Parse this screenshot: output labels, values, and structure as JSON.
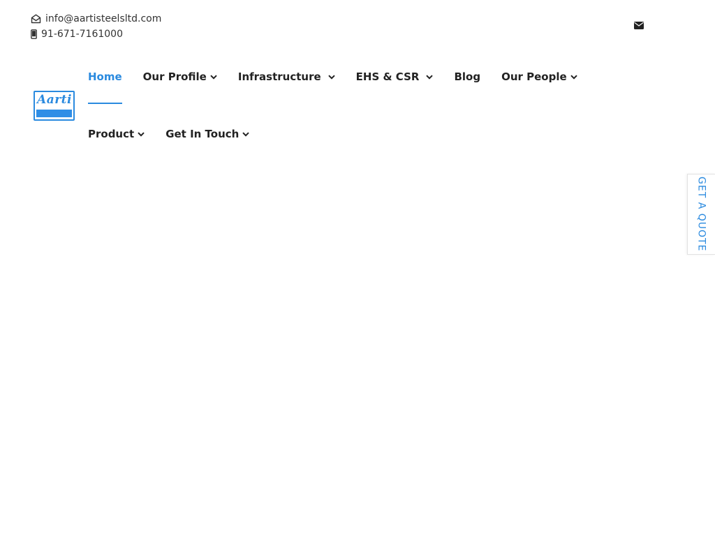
{
  "contact": {
    "email": "info@aartisteelsltd.com",
    "phone": "91-671-7161000",
    "email_icon": "envelope-open-icon",
    "phone_icon": "mobile-phone-icon",
    "top_mail_icon": "envelope-icon"
  },
  "logo": {
    "text": "Aarti",
    "color": "#2a8adf"
  },
  "nav": {
    "items": [
      {
        "label": "Home",
        "has_dropdown": false,
        "active": true
      },
      {
        "label": "Our Profile",
        "has_dropdown": true,
        "active": false
      },
      {
        "label": "Infrastructure",
        "has_dropdown": true,
        "active": false
      },
      {
        "label": "EHS & CSR",
        "has_dropdown": true,
        "active": false
      },
      {
        "label": "Blog",
        "has_dropdown": false,
        "active": false
      },
      {
        "label": "Our People",
        "has_dropdown": true,
        "active": false
      },
      {
        "label": "Product",
        "has_dropdown": true,
        "active": false
      },
      {
        "label": "Get In Touch",
        "has_dropdown": true,
        "active": false
      }
    ]
  },
  "quote_tab": {
    "label": "GET A QUOTE"
  },
  "colors": {
    "accent": "#2a8adf",
    "text": "#222222",
    "background": "#ffffff"
  }
}
